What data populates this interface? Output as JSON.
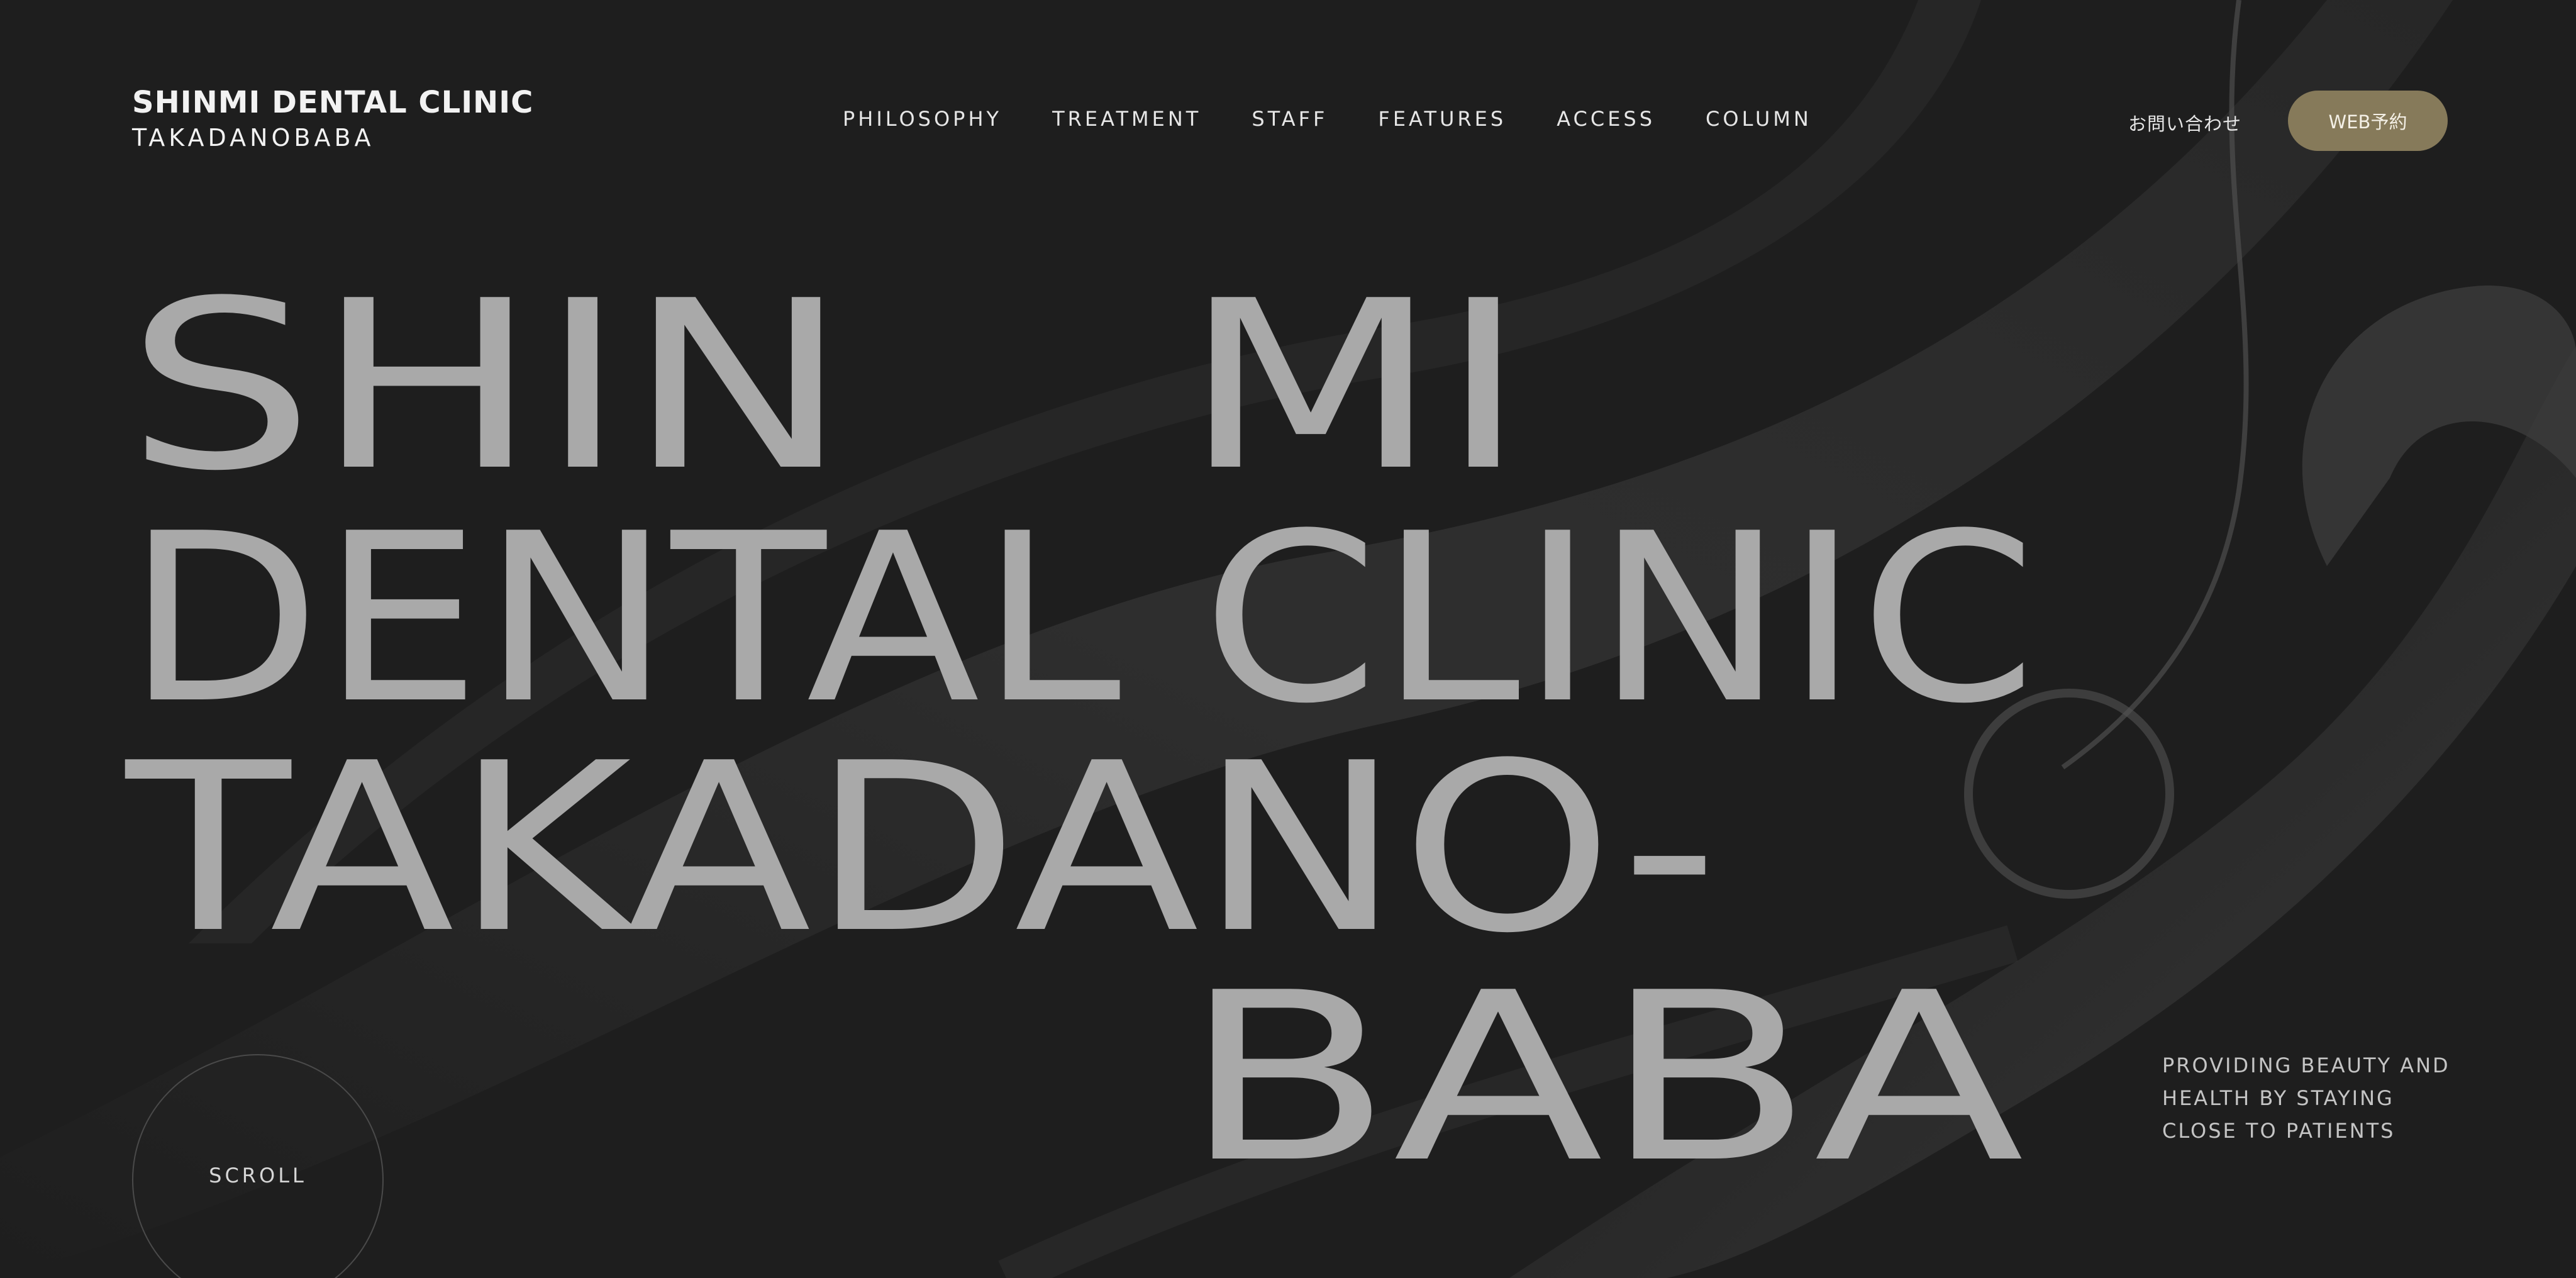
{
  "header": {
    "logo_title": "SHINMI DENTAL CLINIC",
    "logo_subtitle": "TAKADANOBABA",
    "nav_items": [
      {
        "label": "PHILOSOPHY"
      },
      {
        "label": "TREATMENT"
      },
      {
        "label": "STAFF"
      },
      {
        "label": "FEATURES"
      },
      {
        "label": "ACCESS"
      },
      {
        "label": "COLUMN"
      }
    ],
    "contact_label": "お問い合わせ",
    "reserve_label": "WEB予約"
  },
  "hero": {
    "line_shin": "SHIN",
    "line_mi": "MI",
    "line_dental": "DENTAL CLINIC",
    "line_takadano": "TAKADANO-",
    "line_baba": "BABA"
  },
  "tagline": {
    "lines": [
      "PROVIDING BEAUTY AND",
      "HEALTH BY STAYING",
      "CLOSE TO PATIENTS"
    ]
  },
  "scroll": {
    "label": "SCROLL"
  },
  "colors": {
    "background": "#1e1e1e",
    "hero_text": "#a9a9a9",
    "accent_button": "#867a5a",
    "nav_text": "#e6e6e6"
  }
}
